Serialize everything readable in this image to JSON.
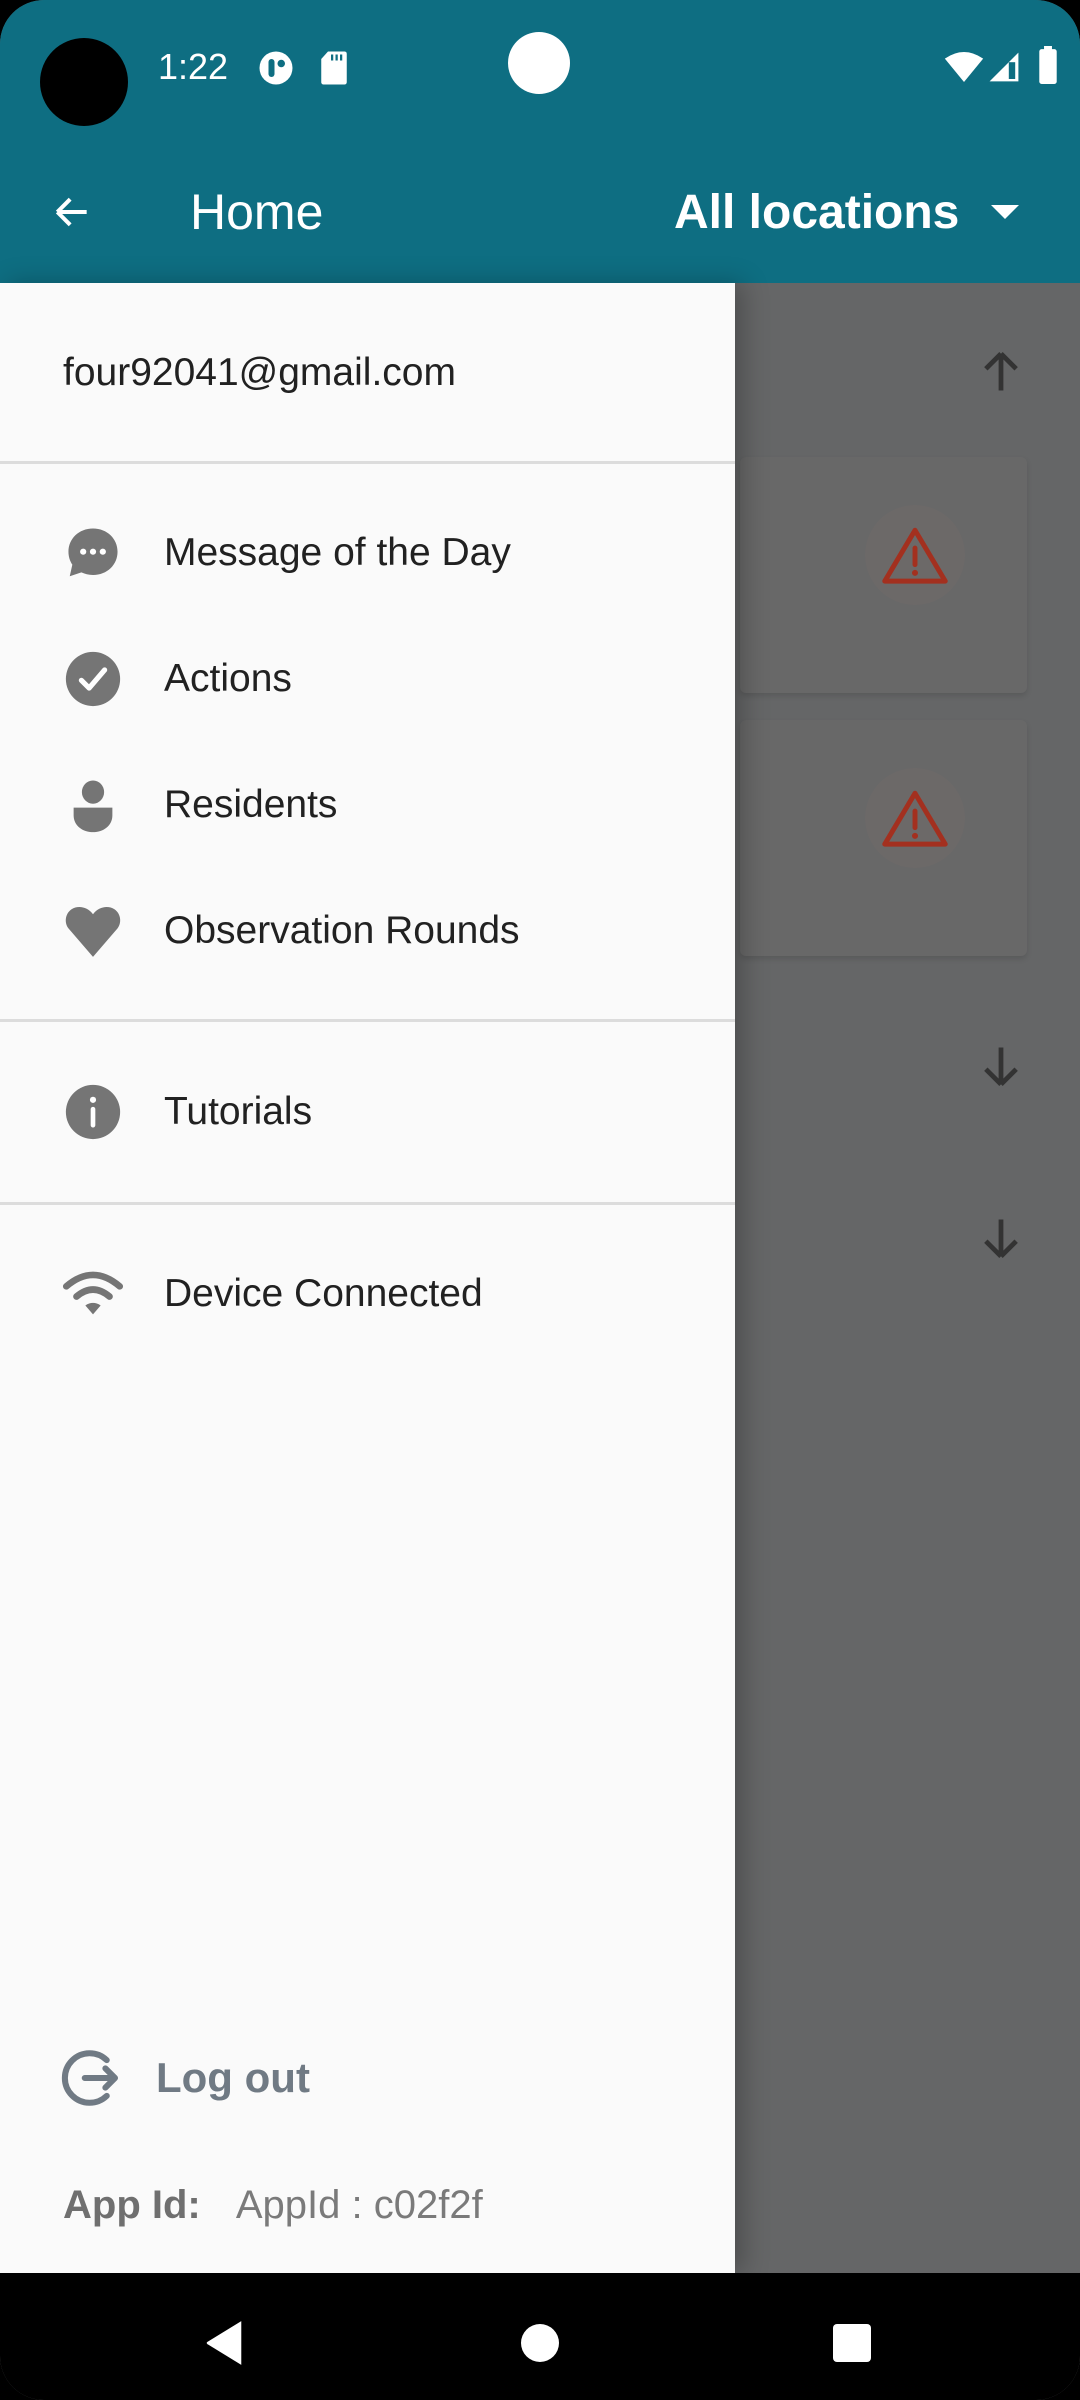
{
  "status_bar": {
    "time": "1:22",
    "icons": [
      "app-notification-icon",
      "sd-card-icon",
      "wifi-icon",
      "cellular-signal-icon",
      "battery-icon"
    ]
  },
  "app_bar": {
    "back_icon": "arrow-back-icon",
    "title": "Home",
    "location_selector": {
      "selected": "All locations",
      "caret_icon": "dropdown-caret-icon"
    },
    "color": "#0E6E82"
  },
  "drawer": {
    "account_email": "four92041@gmail.com",
    "primary_items": [
      {
        "label": "Message of the Day",
        "icon": "chat-bubble-icon"
      },
      {
        "label": "Actions",
        "icon": "check-circle-icon"
      },
      {
        "label": "Residents",
        "icon": "person-icon"
      },
      {
        "label": "Observation Rounds",
        "icon": "heart-icon"
      }
    ],
    "secondary_items": [
      {
        "label": "Tutorials",
        "icon": "info-icon"
      }
    ],
    "status_items": [
      {
        "label": "Device Connected",
        "icon": "wifi-icon"
      }
    ],
    "logout": {
      "label": "Log out",
      "icon": "logout-icon"
    },
    "app_id": {
      "key": "App Id:",
      "value": "AppId : c02f2f"
    }
  },
  "background": {
    "scroll_up_icon": "arrow-up-icon",
    "cards": [
      {
        "icon": "warning-icon",
        "icon_color": "#C0301C"
      },
      {
        "icon": "warning-icon",
        "icon_color": "#C0301C"
      }
    ],
    "scroll_down_icons": [
      "arrow-down-icon",
      "arrow-down-icon"
    ]
  },
  "nav_bar": {
    "back": "nav-back-icon",
    "home": "nav-home-icon",
    "recents": "nav-recents-icon"
  }
}
